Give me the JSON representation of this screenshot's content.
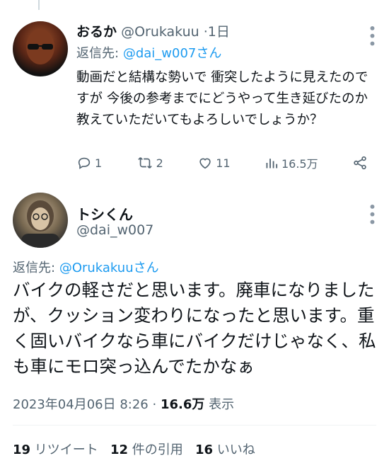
{
  "reply_tweet": {
    "author_name": "おるか",
    "handle": "@Orukakuu",
    "time": "1日",
    "reply_label": "返信先:",
    "reply_handle": "@dai_w007さん",
    "text": "動画だと結構な勢いで 衝突したように見えたのですが 今後の参考までにどうやって生き延びたのか教えていただいてもよろしいでしょうか？",
    "reply_count": "1",
    "retweet_count": "2",
    "like_count": "11",
    "view_count": "16.5万"
  },
  "main_tweet": {
    "author_name": "トシくん",
    "handle": "@dai_w007",
    "reply_label": "返信先:",
    "reply_handle": "@Orukakuuさん",
    "text": "バイクの軽さだと思います。廃車になりましたが、クッション変わりになったと思います。重く固いバイクなら車にバイクだけじゃなく、私も車にモロ突っ込んでたかなぁ",
    "timestamp": "2023年04月06日 8:26",
    "views_value": "16.6万",
    "views_label": "表示",
    "retweets_value": "19",
    "retweets_label": "リツイート",
    "quotes_value": "12",
    "quotes_label": "件の引用",
    "likes_value": "16",
    "likes_label": "いいね"
  }
}
